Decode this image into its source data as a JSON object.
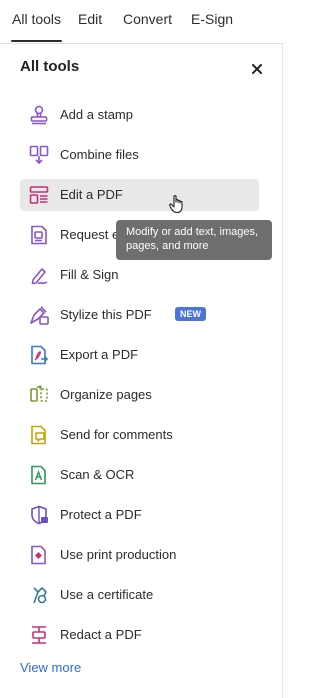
{
  "tabs": [
    {
      "label": "All tools"
    },
    {
      "label": "Edit"
    },
    {
      "label": "Convert"
    },
    {
      "label": "E-Sign"
    }
  ],
  "panel": {
    "title": "All tools",
    "close_icon": "close-icon"
  },
  "tools": [
    {
      "label": "Add a stamp",
      "icon": "stamp-icon"
    },
    {
      "label": "Combine files",
      "icon": "combine-files-icon"
    },
    {
      "label": "Edit a PDF",
      "icon": "edit-pdf-icon"
    },
    {
      "label": "Request e",
      "icon": "request-esign-icon"
    },
    {
      "label": "Fill & Sign",
      "icon": "fill-sign-icon"
    },
    {
      "label": "Stylize this PDF",
      "icon": "stylize-pdf-icon",
      "badge": "NEW"
    },
    {
      "label": "Export a PDF",
      "icon": "export-pdf-icon"
    },
    {
      "label": "Organize pages",
      "icon": "organize-pages-icon"
    },
    {
      "label": "Send for comments",
      "icon": "send-comments-icon"
    },
    {
      "label": "Scan & OCR",
      "icon": "scan-ocr-icon"
    },
    {
      "label": "Protect a PDF",
      "icon": "protect-pdf-icon"
    },
    {
      "label": "Use print production",
      "icon": "print-production-icon"
    },
    {
      "label": "Use a certificate",
      "icon": "certificate-icon"
    },
    {
      "label": "Redact a PDF",
      "icon": "redact-pdf-icon"
    }
  ],
  "tooltip": {
    "text": "Modify or add text, images, pages, and more"
  },
  "view_more": "View more",
  "colors": {
    "accent_link": "#2f6bd1",
    "badge_bg": "#4b75d6",
    "hover_bg": "#e8e8e8",
    "tooltip_bg": "#6e6e6e"
  }
}
